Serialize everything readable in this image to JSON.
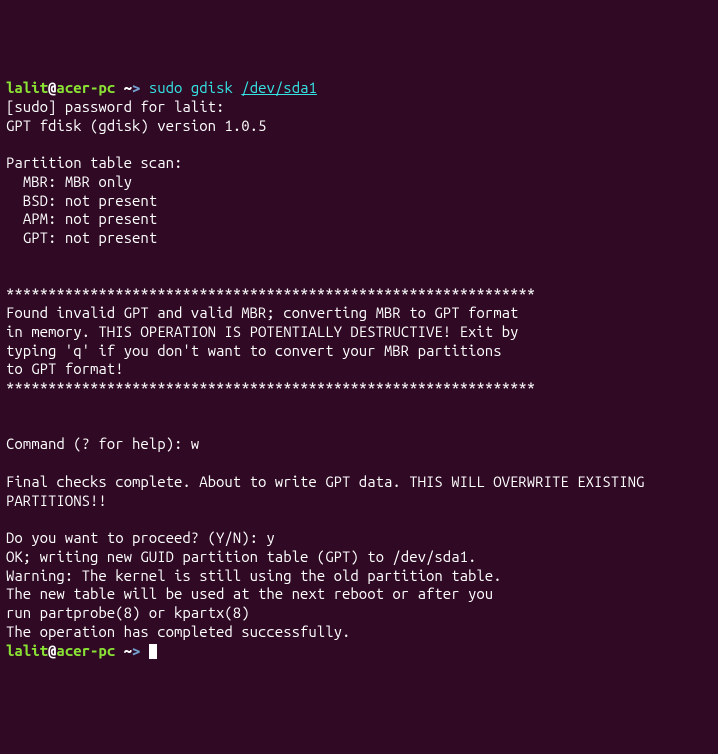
{
  "prompt1": {
    "user": "lalit",
    "at": "@",
    "host": "acer-pc",
    "path": " ~",
    "arrow": "> ",
    "sudo": "sudo",
    "space1": " ",
    "cmd": "gdisk",
    "space2": " ",
    "arg": "/dev/sda1"
  },
  "lines": {
    "l1": "[sudo] password for lalit:",
    "l2": "GPT fdisk (gdisk) version 1.0.5",
    "l3": "",
    "l4": "Partition table scan:",
    "l5": "  MBR: MBR only",
    "l6": "  BSD: not present",
    "l7": "  APM: not present",
    "l8": "  GPT: not present",
    "l9": "",
    "l10": "",
    "l11": "***************************************************************",
    "l12": "Found invalid GPT and valid MBR; converting MBR to GPT format",
    "l13": "in memory. THIS OPERATION IS POTENTIALLY DESTRUCTIVE! Exit by",
    "l14": "typing 'q' if you don't want to convert your MBR partitions",
    "l15": "to GPT format!",
    "l16": "***************************************************************",
    "l17": "",
    "l18": "",
    "l19": "Command (? for help): w",
    "l20": "",
    "l21": "Final checks complete. About to write GPT data. THIS WILL OVERWRITE EXISTING",
    "l22": "PARTITIONS!!",
    "l23": "",
    "l24": "Do you want to proceed? (Y/N): y",
    "l25": "OK; writing new GUID partition table (GPT) to /dev/sda1.",
    "l26": "Warning: The kernel is still using the old partition table.",
    "l27": "The new table will be used at the next reboot or after you",
    "l28": "run partprobe(8) or kpartx(8)",
    "l29": "The operation has completed successfully."
  },
  "prompt2": {
    "user": "lalit",
    "at": "@",
    "host": "acer-pc",
    "path": " ~",
    "arrow": "> "
  }
}
